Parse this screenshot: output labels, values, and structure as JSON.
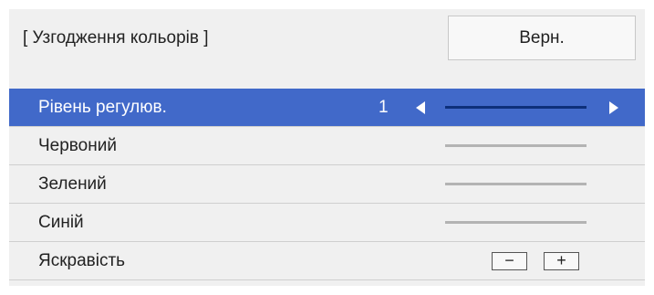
{
  "header": {
    "title": "[ Узгодження кольорів ]",
    "reset_label": "Верн."
  },
  "rows": [
    {
      "label": "Рівень регулюв.",
      "value": "1",
      "selected": true
    },
    {
      "label": "Червоний"
    },
    {
      "label": "Зелений"
    },
    {
      "label": "Синій"
    },
    {
      "label": "Яскравість",
      "minus": "−",
      "plus": "+"
    }
  ],
  "colors": {
    "selection": "#4169c9",
    "panel": "#f0f0f0",
    "active_track": "#0d2f7a",
    "inactive_track": "#b3b3b3"
  },
  "icons": [
    "arrow-left-icon",
    "arrow-right-icon"
  ]
}
